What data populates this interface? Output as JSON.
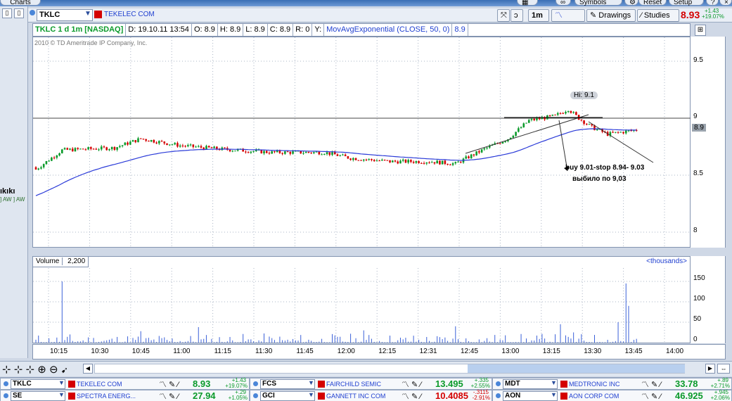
{
  "top": {
    "tab": "Charts",
    "buttons": [
      "Symbols",
      "Reset",
      "Setup"
    ]
  },
  "symbol": {
    "ticker": "TKLC",
    "company": "TEKELEC COM",
    "interval": "1m",
    "style": "Style",
    "drawings": "Drawings",
    "studies": "Studies",
    "last": "8.93",
    "change": "+1.43",
    "change_pct": "+19.07%"
  },
  "info": {
    "title": "TKLC 1 d 1m [NASDAQ]",
    "date": "D: 19.10.11 13:54",
    "open": "O: 8.9",
    "high": "H: 8.9",
    "low": "L: 8.9",
    "close": "C: 8.9",
    "range": "R: 0",
    "y": "Y:",
    "study": "MovAvgExponential (CLOSE, 50, 0)",
    "study_value": "8.9"
  },
  "copyright": "2010 © TD Ameritrade IP Company, Inc.",
  "annotations": {
    "hi_label": "Hi: 9.1",
    "current_label": "8.9",
    "note_line1": "buy 9.01-stop 8.94- 9.03",
    "note_line2": "выбило по 9,03"
  },
  "price_axis": [
    "9.5",
    "9",
    "8.5",
    "8"
  ],
  "volume": {
    "label": "Volume",
    "value": "2,200",
    "units": "<thousands>",
    "axis": [
      "150",
      "100",
      "50",
      "0"
    ]
  },
  "time_axis": [
    "10:15",
    "10:30",
    "10:45",
    "11:00",
    "11:15",
    "11:30",
    "11:45",
    "12:00",
    "12:15",
    "12:31",
    "12:45",
    "13:00",
    "13:15",
    "13:30",
    "13:45",
    "14:00"
  ],
  "left_partial": {
    "line1": "ıkıkı",
    "line2": "] AW ] AW"
  },
  "watchlist": [
    [
      {
        "symbol": "TKLC",
        "company": "TEKELEC COM",
        "price": "8.93",
        "chg": "+1.43",
        "pct": "+19.07%",
        "dir": "up"
      },
      {
        "symbol": "FCS",
        "company": "FAIRCHILD SEMIC",
        "price": "13.495",
        "chg": "+.335",
        "pct": "+2.55%",
        "dir": "up"
      },
      {
        "symbol": "MDT",
        "company": "MEDTRONIC INC",
        "price": "33.78",
        "chg": "+.89",
        "pct": "+2.71%",
        "dir": "up"
      }
    ],
    [
      {
        "symbol": "SE",
        "company": "SPECTRA ENERG...",
        "price": "27.94",
        "chg": "+.29",
        "pct": "+1.05%",
        "dir": "up"
      },
      {
        "symbol": "GCI",
        "company": "GANNETT INC COM",
        "price": "10.4085",
        "chg": "-.3115",
        "pct": "-2.91%",
        "dir": "down"
      },
      {
        "symbol": "AON",
        "company": "AON CORP COM",
        "price": "46.925",
        "chg": "+.945",
        "pct": "+2.06%",
        "dir": "up"
      }
    ]
  ],
  "colors": {
    "up": "#0a9a2a",
    "down": "#d40000",
    "ma": "#2a3ad8",
    "bg": "#cfd8e6"
  }
}
